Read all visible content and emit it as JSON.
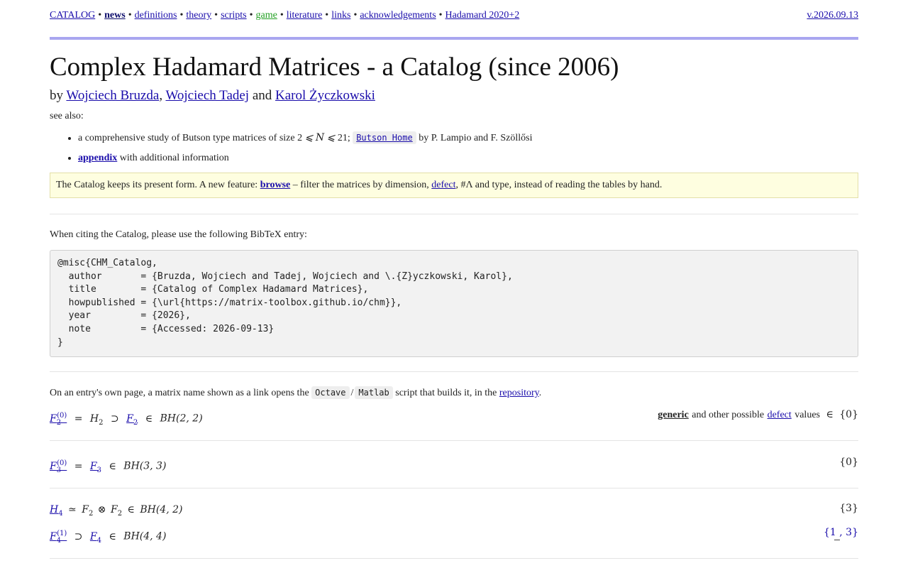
{
  "nav": {
    "items": [
      {
        "label": "CATALOG",
        "style": "normal"
      },
      {
        "label": "news",
        "style": "strong"
      },
      {
        "label": "definitions",
        "style": "normal"
      },
      {
        "label": "theory",
        "style": "normal"
      },
      {
        "label": "scripts",
        "style": "normal"
      },
      {
        "label": "game",
        "style": "game"
      },
      {
        "label": "literature",
        "style": "normal"
      },
      {
        "label": "links",
        "style": "normal"
      },
      {
        "label": "acknowledgements",
        "style": "normal"
      },
      {
        "label": "Hadamard 2020+2",
        "style": "normal"
      }
    ],
    "separator": "•",
    "version": "v.2026.09.13"
  },
  "header": {
    "title": "Complex Hadamard Matrices - a Catalog (since 2006)",
    "by": "by",
    "authors": [
      "Wojciech Bruzda",
      "Wojciech Tadej",
      "Karol Życzkowski"
    ],
    "comma": ",",
    "and": "and"
  },
  "see_also": {
    "label": "see also:",
    "item1": {
      "prefix": "a comprehensive study of Butson type matrices of size 2",
      "le1": "⩽",
      "n": "N",
      "le2": "⩽",
      "suffix": "21;",
      "chip": "Butson Home",
      "by": "by P. Lampio and F. Szöllősi"
    },
    "item2": {
      "link": "appendix",
      "text": "with additional information"
    }
  },
  "notice": {
    "prefix": "The Catalog keeps its present form. A new feature:",
    "browse": "browse",
    "middle": "– filter the matrices by dimension,",
    "defect": "defect",
    "suffix": ", #Λ and type, instead of reading the tables by hand."
  },
  "citation": {
    "intro": "When citing the Catalog, please use the following BibTeX entry:",
    "bibtex": "@misc{CHM_Catalog,\n  author       = {Bruzda, Wojciech and Tadej, Wojciech and \\.{Z}yczkowski, Karol},\n  title        = {Catalog of Complex Hadamard Matrices},\n  howpublished = {\\url{https://matrix-toolbox.github.io/chm}},\n  year         = {2026},\n  note         = {Accessed: 2026-09-13}\n}"
  },
  "entries_intro": {
    "prefix": "On an entry's own page, a matrix name shown as a link opens the",
    "chip1": "Octave",
    "slash": "/",
    "chip2": "Matlab",
    "middle": "script that builds it, in the",
    "repo": "repository",
    "end": "."
  },
  "matrices": [
    {
      "name": "F2-0",
      "f1": "F",
      "f1_sub": "2",
      "f1_sup": "(0)",
      "op1": "=",
      "f2": "H",
      "f2_sub": "2",
      "op2": "⊃",
      "f3": "F",
      "f3_sub": "2",
      "op3": "∈",
      "bh": "BH(2, 2)",
      "defect_generic": "generic",
      "defect_mid": "and other possible",
      "defect_link": "defect",
      "defect_tail": "values",
      "defect_in": "∈",
      "defect_set": "{0}"
    },
    {
      "name": "F3-0",
      "f1": "F",
      "f1_sub": "3",
      "f1_sup": "(0)",
      "op1": "=",
      "f2": "F",
      "f2_sub": "3",
      "op3": "∈",
      "bh": "BH(3, 3)",
      "defect_set": "{0}"
    },
    {
      "name": "H4",
      "f1": "H",
      "f1_sub": "4",
      "op1": "≃",
      "f2": "F",
      "f2_sub": "2",
      "op2": "⊗",
      "f3": "F",
      "f3_sub": "2",
      "op3": "∈",
      "bh": "BH(4, 2)",
      "defect_set": "{3}"
    },
    {
      "name": "F4-1",
      "f1": "F",
      "f1_sub": "4",
      "f1_sup": "(1)",
      "op2": "⊃",
      "f3": "F",
      "f3_sub": "4",
      "op3": "∈",
      "bh": "BH(4, 4)",
      "defect_set": "{1 , 3}"
    }
  ],
  "colors": {
    "link": "#1a0dab",
    "rule": "#a9a6f0",
    "notice_bg": "#fefee0",
    "game": "#22a022"
  }
}
